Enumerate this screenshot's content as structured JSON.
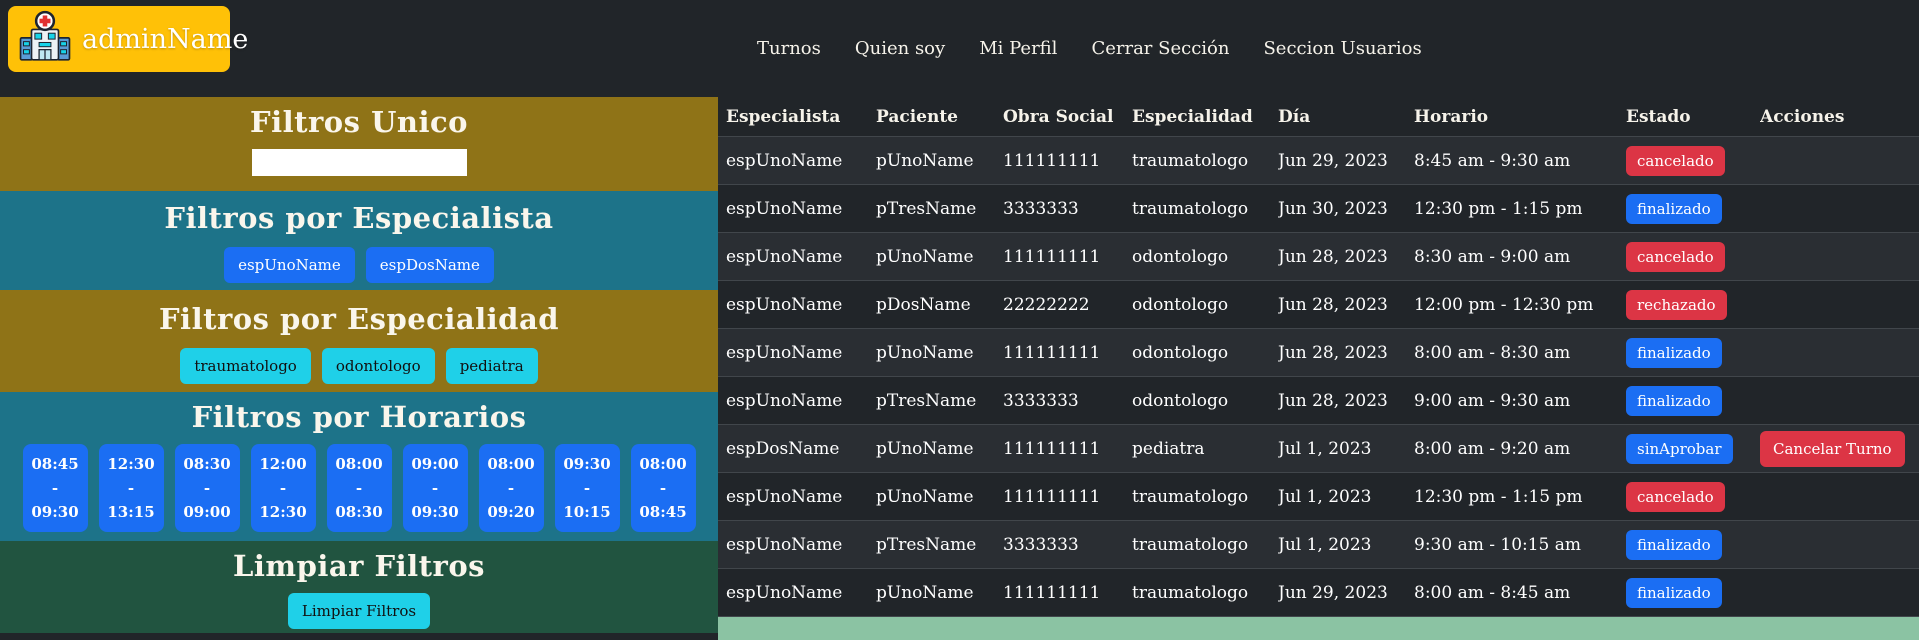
{
  "colors": {
    "page-bg": "#212529",
    "olive": "#8f7317",
    "teal": "#1d7389",
    "green": "#215440",
    "strip-green": "#8bc3a3",
    "yellow": "#ffc107",
    "blue": "#1b6ef3",
    "cyan": "#1fd0e8",
    "red": "#dc3545",
    "row-alt": "#2a2e33",
    "row-base": "#212529",
    "row-border": "#41464b"
  },
  "brand": {
    "name": "adminName",
    "icon": "hospital-icon"
  },
  "nav": {
    "items": [
      {
        "label": "Turnos"
      },
      {
        "label": "Quien soy"
      },
      {
        "label": "Mi Perfil"
      },
      {
        "label": "Cerrar Sección"
      },
      {
        "label": "Seccion Usuarios"
      }
    ]
  },
  "sidebar": {
    "unico": {
      "title": "Filtros Unico",
      "input_value": "",
      "input_placeholder": ""
    },
    "especialista": {
      "title": "Filtros por Especialista",
      "buttons": [
        "espUnoName",
        "espDosName"
      ]
    },
    "especialidad": {
      "title": "Filtros por Especialidad",
      "buttons": [
        "traumatologo",
        "odontologo",
        "pediatra"
      ]
    },
    "horarios": {
      "title": "Filtros por Horarios",
      "slots": [
        {
          "start": "08:45",
          "sep": "-",
          "end": "09:30"
        },
        {
          "start": "12:30",
          "sep": "-",
          "end": "13:15"
        },
        {
          "start": "08:30",
          "sep": "-",
          "end": "09:00"
        },
        {
          "start": "12:00",
          "sep": "-",
          "end": "12:30"
        },
        {
          "start": "08:00",
          "sep": "-",
          "end": "08:30"
        },
        {
          "start": "09:00",
          "sep": "-",
          "end": "09:30"
        },
        {
          "start": "08:00",
          "sep": "-",
          "end": "09:20"
        },
        {
          "start": "09:30",
          "sep": "-",
          "end": "10:15"
        },
        {
          "start": "08:00",
          "sep": "-",
          "end": "08:45"
        }
      ]
    },
    "limpiar": {
      "title": "Limpiar Filtros",
      "button_label": "Limpiar Filtros"
    }
  },
  "table": {
    "columns": [
      "Especialista",
      "Paciente",
      "Obra Social",
      "Especialidad",
      "Día",
      "Horario",
      "Estado",
      "Acciones"
    ],
    "rows": [
      {
        "especialista": "espUnoName",
        "paciente": "pUnoName",
        "obra_social": "111111111",
        "especialidad": "traumatologo",
        "dia": "Jun 29, 2023",
        "horario": "8:45 am - 9:30 am",
        "estado": "cancelado",
        "estado_variant": "danger",
        "action": ""
      },
      {
        "especialista": "espUnoName",
        "paciente": "pTresName",
        "obra_social": "3333333",
        "especialidad": "traumatologo",
        "dia": "Jun 30, 2023",
        "horario": "12:30 pm - 1:15 pm",
        "estado": "finalizado",
        "estado_variant": "primary",
        "action": ""
      },
      {
        "especialista": "espUnoName",
        "paciente": "pUnoName",
        "obra_social": "111111111",
        "especialidad": "odontologo",
        "dia": "Jun 28, 2023",
        "horario": "8:30 am - 9:00 am",
        "estado": "cancelado",
        "estado_variant": "danger",
        "action": ""
      },
      {
        "especialista": "espUnoName",
        "paciente": "pDosName",
        "obra_social": "22222222",
        "especialidad": "odontologo",
        "dia": "Jun 28, 2023",
        "horario": "12:00 pm - 12:30 pm",
        "estado": "rechazado",
        "estado_variant": "danger",
        "action": ""
      },
      {
        "especialista": "espUnoName",
        "paciente": "pUnoName",
        "obra_social": "111111111",
        "especialidad": "odontologo",
        "dia": "Jun 28, 2023",
        "horario": "8:00 am - 8:30 am",
        "estado": "finalizado",
        "estado_variant": "primary",
        "action": ""
      },
      {
        "especialista": "espUnoName",
        "paciente": "pTresName",
        "obra_social": "3333333",
        "especialidad": "odontologo",
        "dia": "Jun 28, 2023",
        "horario": "9:00 am - 9:30 am",
        "estado": "finalizado",
        "estado_variant": "primary",
        "action": ""
      },
      {
        "especialista": "espDosName",
        "paciente": "pUnoName",
        "obra_social": "111111111",
        "especialidad": "pediatra",
        "dia": "Jul 1, 2023",
        "horario": "8:00 am - 9:20 am",
        "estado": "sinAprobar",
        "estado_variant": "primary",
        "action": "Cancelar Turno"
      },
      {
        "especialista": "espUnoName",
        "paciente": "pUnoName",
        "obra_social": "111111111",
        "especialidad": "traumatologo",
        "dia": "Jul 1, 2023",
        "horario": "12:30 pm - 1:15 pm",
        "estado": "cancelado",
        "estado_variant": "danger",
        "action": ""
      },
      {
        "especialista": "espUnoName",
        "paciente": "pTresName",
        "obra_social": "3333333",
        "especialidad": "traumatologo",
        "dia": "Jul 1, 2023",
        "horario": "9:30 am - 10:15 am",
        "estado": "finalizado",
        "estado_variant": "primary",
        "action": ""
      },
      {
        "especialista": "espUnoName",
        "paciente": "pUnoName",
        "obra_social": "111111111",
        "especialidad": "traumatologo",
        "dia": "Jun 29, 2023",
        "horario": "8:00 am - 8:45 am",
        "estado": "finalizado",
        "estado_variant": "primary",
        "action": ""
      }
    ]
  }
}
